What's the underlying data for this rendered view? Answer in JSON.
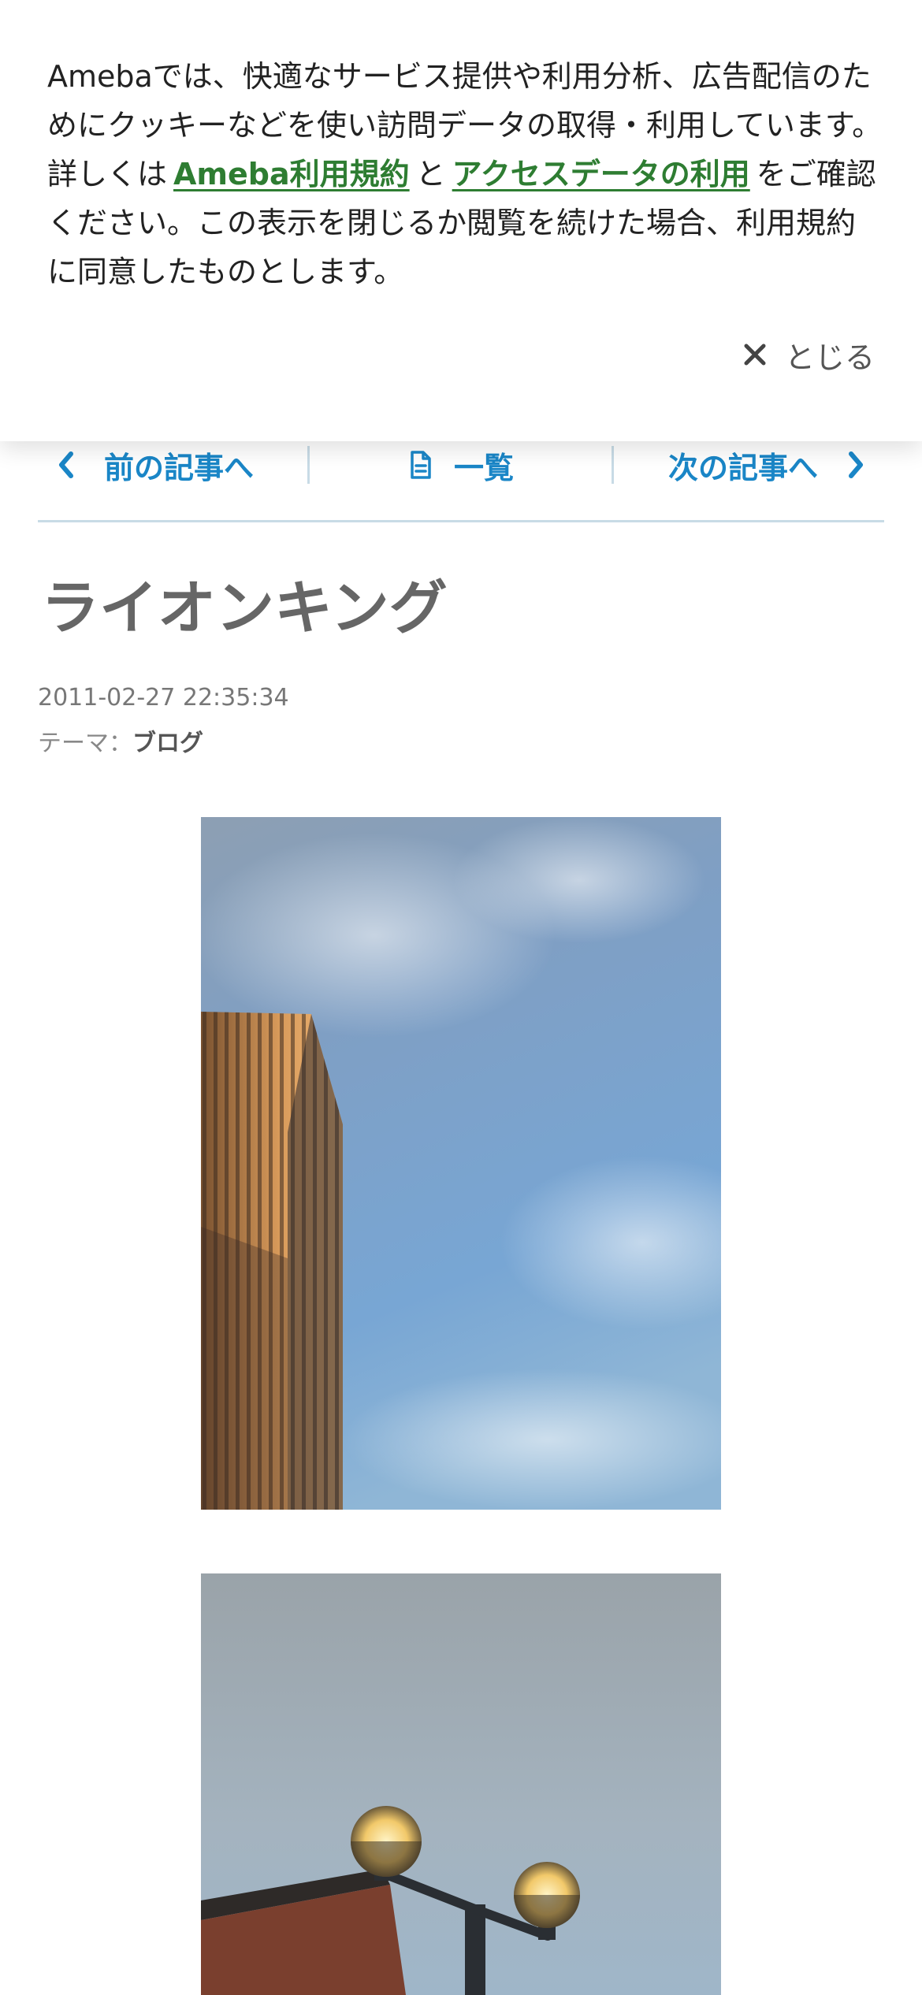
{
  "cookie_banner": {
    "text_before": "Amebaでは、快適なサービス提供や利用分析、広告配信のためにクッキーなどを使い訪問データの取得・利用しています。詳しくは",
    "link_terms": "Ameba利用規約",
    "text_and": "と",
    "link_access_data": "アクセスデータの利用",
    "text_after": "をご確認ください。この表示を閉じるか閲覧を続けた場合、利用規約に同意したものとします。",
    "close_label": "とじる",
    "link_color": "#2e7d32"
  },
  "article_nav": {
    "prev_label": "前の記事へ",
    "list_label": "一覧",
    "next_label": "次の記事へ",
    "accent_color": "#1a86c7"
  },
  "article": {
    "title": "ライオンキング",
    "date": "2011-02-27 22:35:34",
    "theme_label": "テーマ：",
    "theme_value": "ブログ"
  },
  "photos": [
    {
      "subject": "tall building against blue sky"
    },
    {
      "subject": "street lamps against sky"
    }
  ]
}
